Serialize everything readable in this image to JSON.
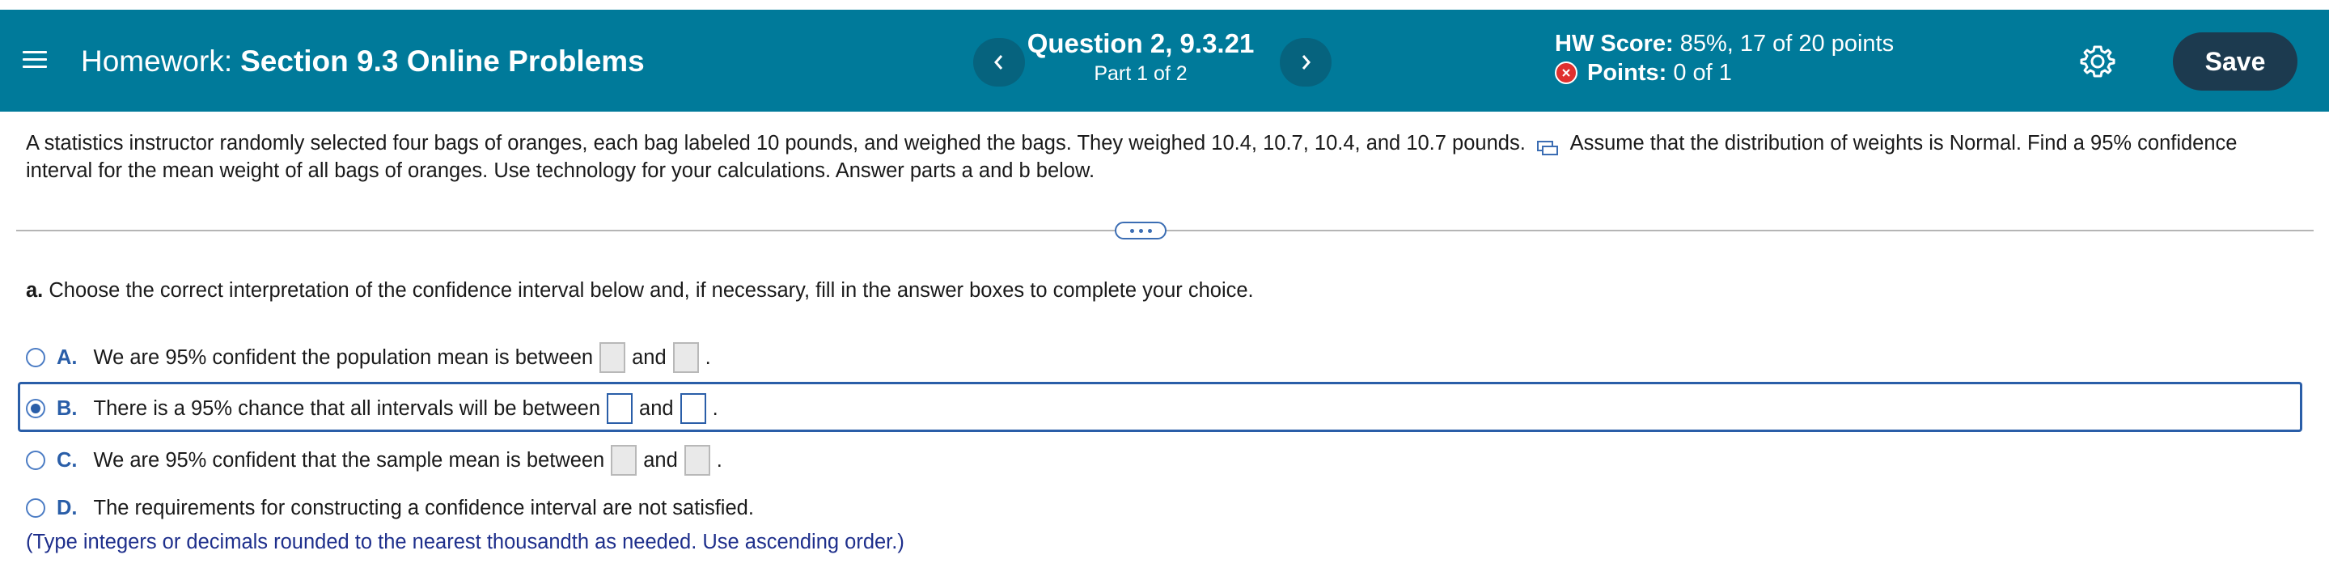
{
  "header": {
    "menu_icon": "hamburger-menu-icon",
    "title_prefix": "Homework:",
    "title_name": "Section 9.3 Online Problems",
    "question_title": "Question 2, 9.3.21",
    "question_part": "Part 1 of 2",
    "prev_icon": "chevron-left-icon",
    "next_icon": "chevron-right-icon",
    "hw_score_label": "HW Score:",
    "hw_score_value": "85%, 17 of 20 points",
    "points_label": "Points:",
    "points_value": "0 of 1",
    "points_status_icon": "x-circle-icon",
    "settings_icon": "gear-icon",
    "save_label": "Save",
    "colors": {
      "header_bg": "#007a9a",
      "nav_btn_bg": "#06637e",
      "save_bg": "#1c3a4f",
      "error_red": "#e0302e",
      "accent_blue": "#2a5ea8",
      "hint_blue": "#1e2f8c"
    }
  },
  "question": {
    "text_before_icon": "A statistics instructor randomly selected four bags of oranges, each bag labeled 10 pounds, and weighed the bags. They weighed 10.4, 10.7, 10.4, and 10.7 pounds.",
    "data_icon": "copy-data-icon",
    "text_after_icon": "Assume that the distribution of weights is Normal. Find a 95% confidence interval for the mean weight of all bags of oranges. Use technology for your calculations. Answer parts a and b below."
  },
  "more_icon": "ellipsis-icon",
  "part_a": {
    "label": "a.",
    "prompt": "Choose the correct interpretation of the confidence interval below and, if necessary, fill in the answer boxes to complete your choice."
  },
  "options": [
    {
      "letter": "A.",
      "text": "We are 95% confident the population mean is between",
      "and": "and",
      "end": "."
    },
    {
      "letter": "B.",
      "text": "There is a 95% chance that all intervals will be between",
      "and": "and",
      "end": ".",
      "selected": true
    },
    {
      "letter": "C.",
      "text": "We are 95% confident that the sample mean is between",
      "and": "and",
      "end": "."
    },
    {
      "letter": "D.",
      "text": "The requirements for constructing a confidence interval are not satisfied."
    }
  ],
  "hint": "(Type integers or decimals rounded to the nearest thousandth as needed. Use ascending order.)"
}
